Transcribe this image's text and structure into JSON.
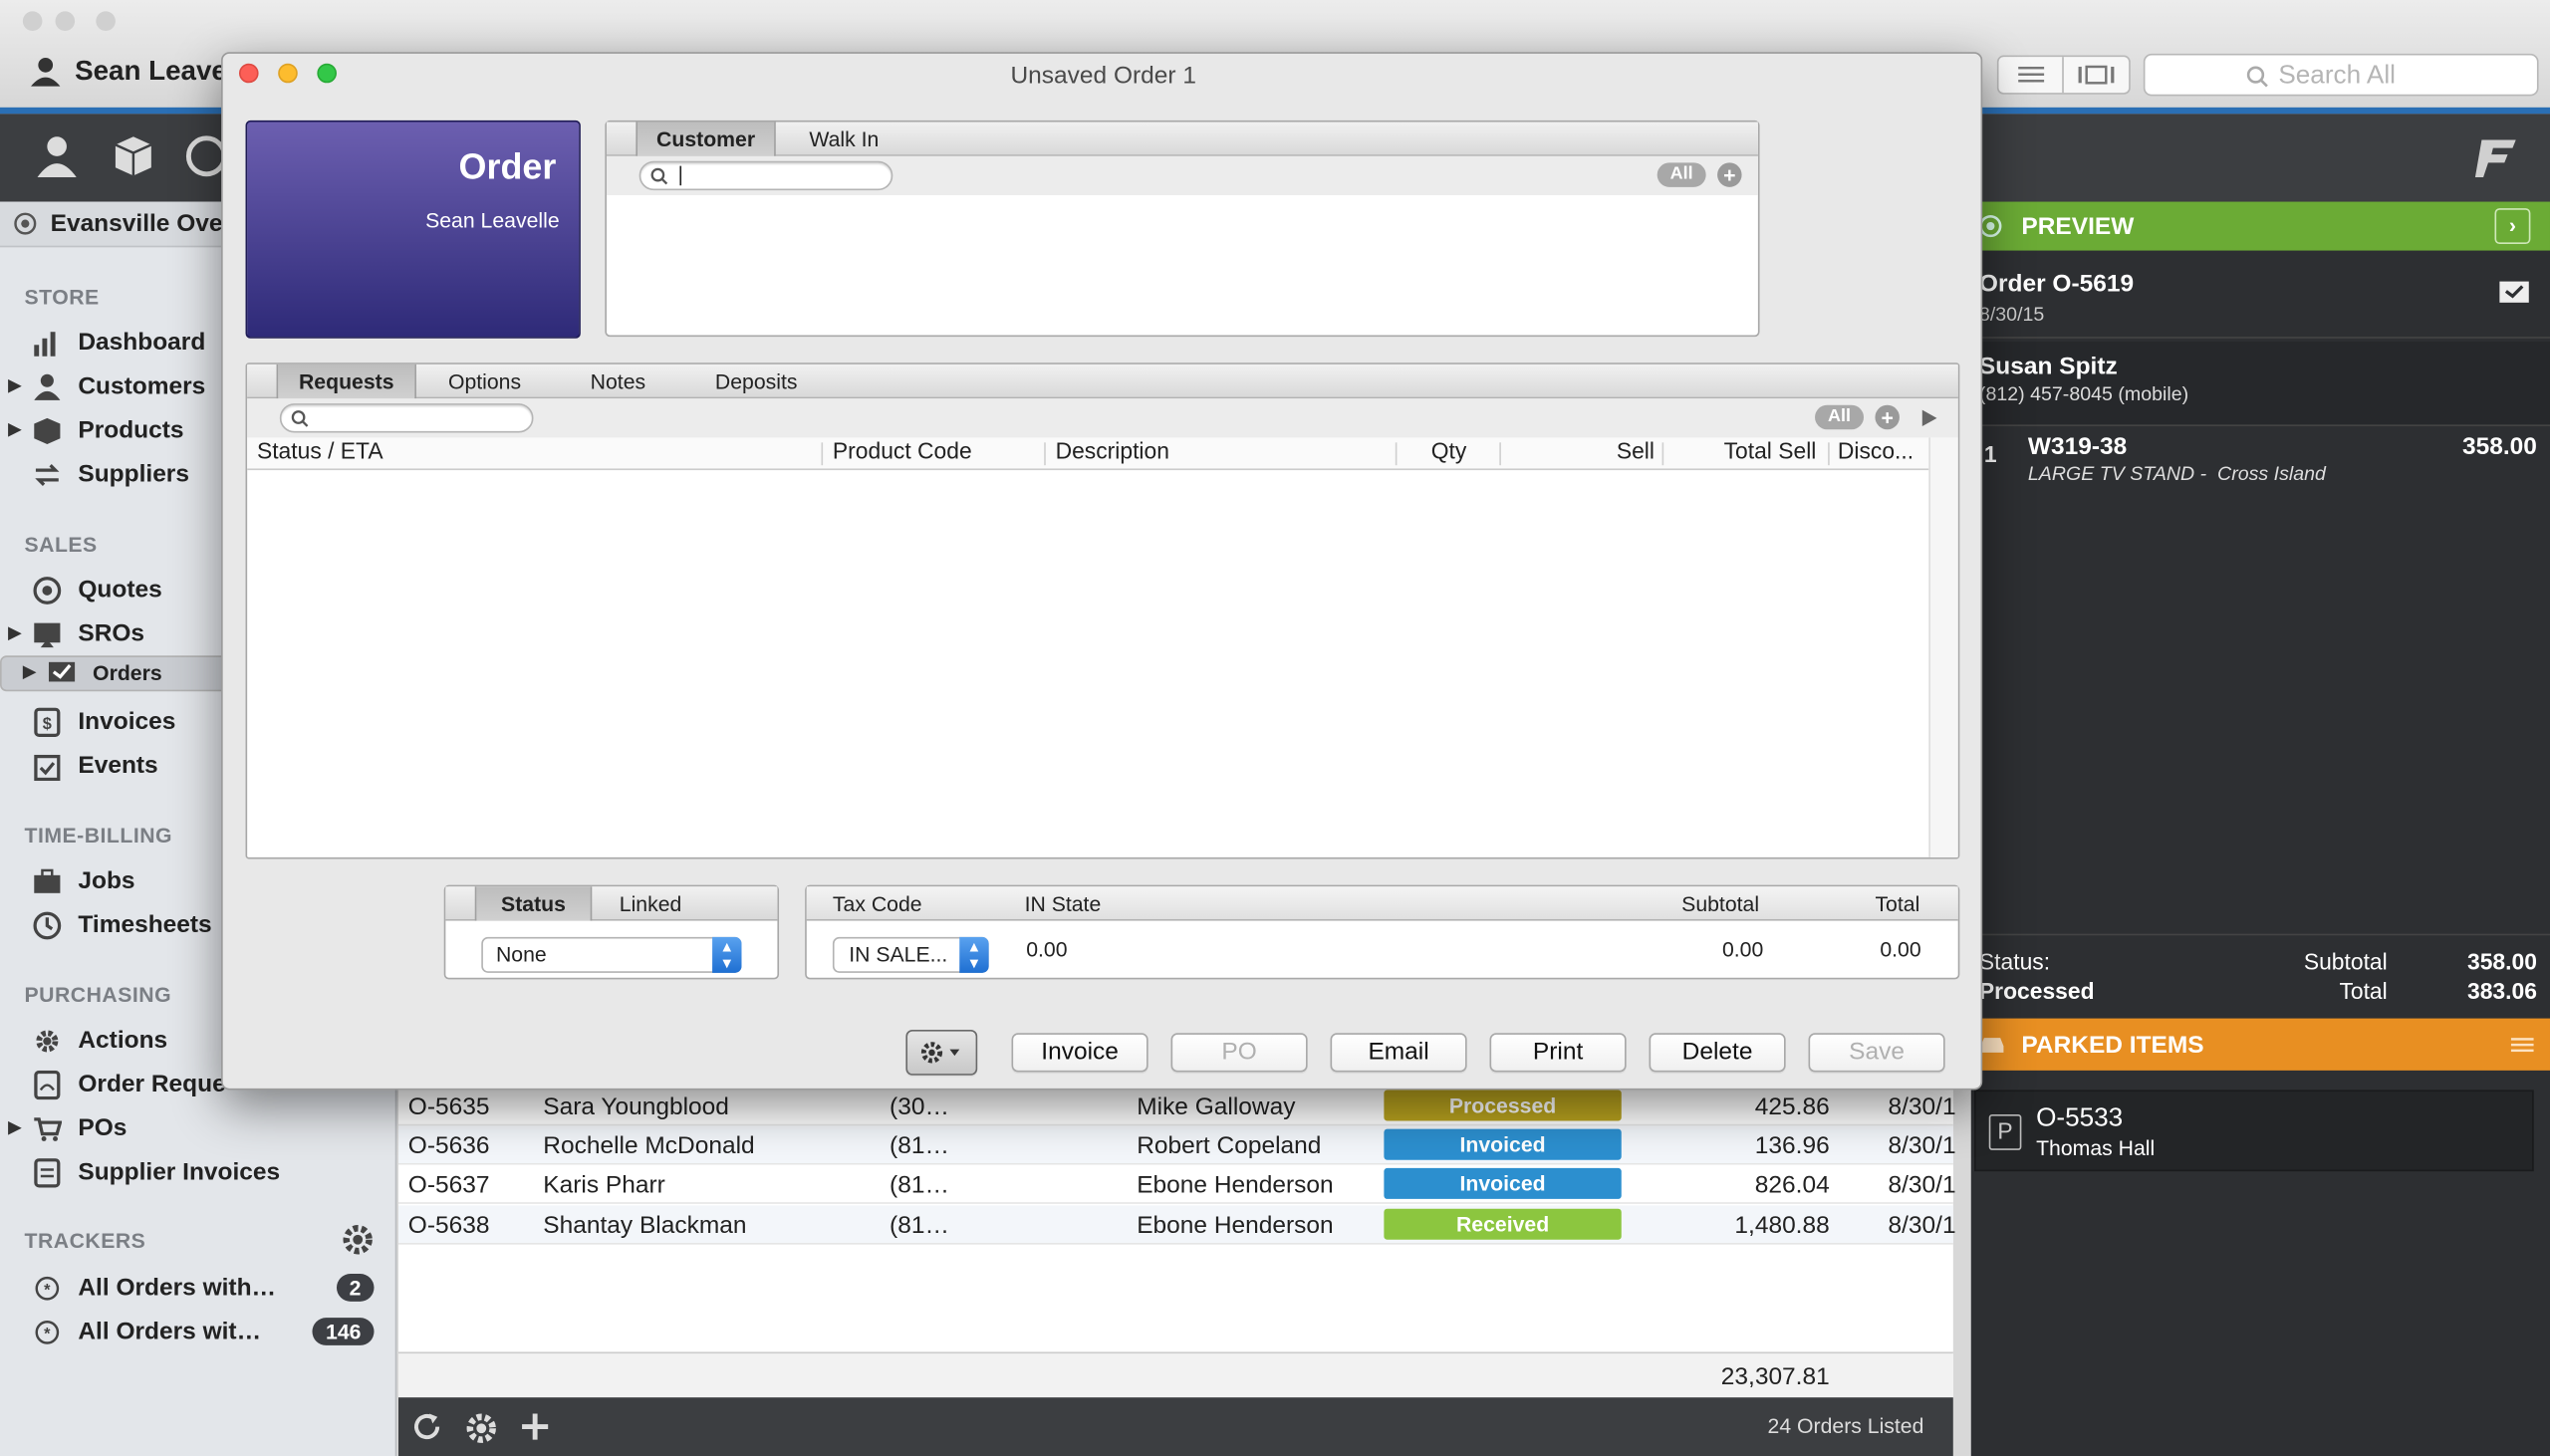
{
  "window": {
    "user_name": "Sean Leave",
    "search_placeholder": "Search All",
    "org_name": "Evansville Over"
  },
  "sidebar": {
    "sections": [
      {
        "title": "STORE",
        "items": [
          "Dashboard",
          "Customers",
          "Products",
          "Suppliers"
        ]
      },
      {
        "title": "SALES",
        "items": [
          "Quotes",
          "SROs",
          "Orders",
          "Invoices",
          "Events"
        ]
      },
      {
        "title": "TIME-BILLING",
        "items": [
          "Jobs",
          "Timesheets"
        ]
      },
      {
        "title": "PURCHASING",
        "items": [
          "Actions",
          "Order Reque",
          "POs",
          "Supplier Invoices"
        ]
      },
      {
        "title": "TRACKERS",
        "items": []
      }
    ],
    "trackers": [
      {
        "label": "All Orders with…",
        "count": "2"
      },
      {
        "label": "All Orders wit…",
        "count": "146"
      }
    ]
  },
  "list": {
    "rows": [
      {
        "id": "O-5635",
        "customer": "Sara Youngblood",
        "phone": "(30…",
        "rep": "Mike Galloway",
        "status": "Processed",
        "status_color": "#b8a21e",
        "total": "425.86",
        "date": "8/30/1"
      },
      {
        "id": "O-5636",
        "customer": "Rochelle McDonald",
        "phone": "(81…",
        "rep": "Robert Copeland",
        "status": "Invoiced",
        "status_color": "#2c8fcf",
        "total": "136.96",
        "date": "8/30/1"
      },
      {
        "id": "O-5637",
        "customer": "Karis Pharr",
        "phone": "(81…",
        "rep": "Ebone Henderson",
        "status": "Invoiced",
        "status_color": "#2c8fcf",
        "total": "826.04",
        "date": "8/30/1"
      },
      {
        "id": "O-5638",
        "customer": "Shantay Blackman",
        "phone": "(81…",
        "rep": "Ebone Henderson",
        "status": "Received",
        "status_color": "#8cc63f",
        "total": "1,480.88",
        "date": "8/30/1"
      }
    ],
    "grand_total": "23,307.81",
    "count_label": "24 Orders Listed"
  },
  "preview": {
    "header": "PREVIEW",
    "order_number": "Order O-5619",
    "order_date": "8/30/15",
    "customer_name": "Susan Spitz",
    "customer_phone": "(812) 457-8045 (mobile)",
    "line_qty": "1",
    "line_code": "W319-38",
    "line_desc": "LARGE TV STAND -  Cross Island",
    "line_amount": "358.00",
    "status_label": "Status:",
    "status_value": "Processed",
    "subtotal_label": "Subtotal",
    "subtotal_value": "358.00",
    "total_label": "Total",
    "total_value": "383.06",
    "parked_header": "PARKED ITEMS",
    "parked_id": "O-5533",
    "parked_name": "Thomas Hall",
    "parked_badge": "P"
  },
  "dialog": {
    "title": "Unsaved Order 1",
    "order_label": "Order",
    "order_user": "Sean Leavelle",
    "customer_tabs": [
      "Customer",
      "Walk In"
    ],
    "all_label": "All",
    "request_tabs": [
      "Requests",
      "Options",
      "Notes",
      "Deposits"
    ],
    "columns": [
      "Status / ETA",
      "Product Code",
      "Description",
      "Qty",
      "Sell",
      "Total Sell",
      "Disco..."
    ],
    "status_tabs": [
      "Status",
      "Linked"
    ],
    "status_value": "None",
    "tax_headers": [
      "Tax Code",
      "IN State",
      "Subtotal",
      "Total"
    ],
    "tax_code": "IN SALE...",
    "tax_in_state": "0.00",
    "tax_subtotal": "0.00",
    "tax_total": "0.00",
    "buttons": {
      "invoice": "Invoice",
      "po": "PO",
      "email": "Email",
      "print": "Print",
      "delete": "Delete",
      "save": "Save"
    }
  }
}
